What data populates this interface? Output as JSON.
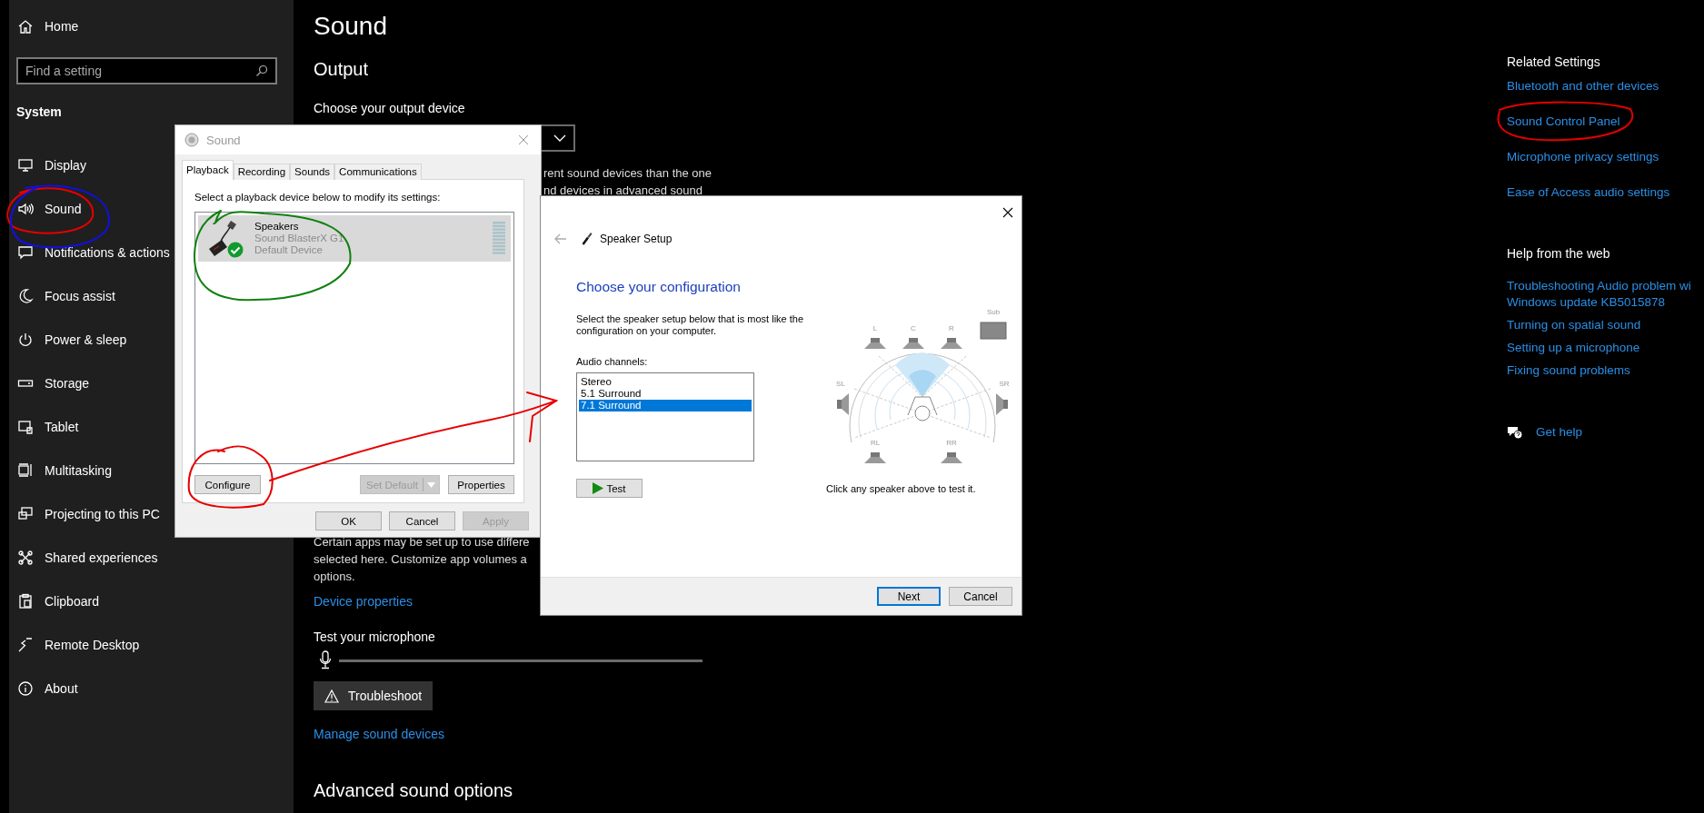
{
  "sidebar": {
    "home": "Home",
    "search": {
      "placeholder": "Find a setting"
    },
    "section": "System",
    "items": [
      {
        "label": "Display"
      },
      {
        "label": "Sound"
      },
      {
        "label": "Notifications & actions"
      },
      {
        "label": "Focus assist"
      },
      {
        "label": "Power & sleep"
      },
      {
        "label": "Storage"
      },
      {
        "label": "Tablet"
      },
      {
        "label": "Multitasking"
      },
      {
        "label": "Projecting to this PC"
      },
      {
        "label": "Shared experiences"
      },
      {
        "label": "Clipboard"
      },
      {
        "label": "Remote Desktop"
      },
      {
        "label": "About"
      }
    ]
  },
  "main": {
    "title": "Sound",
    "output_heading": "Output",
    "output_label": "Choose your output device",
    "output_note": [
      "rent sound devices than the one",
      "nd devices in advanced sound"
    ],
    "app_note": [
      "Certain apps may be set up to use differe",
      "selected here. Customize app volumes a",
      "options."
    ],
    "device_properties": "Device properties",
    "mic_label": "Test your microphone",
    "mic_meter": {
      "level": 0
    },
    "troubleshoot": "Troubleshoot",
    "manage": "Manage sound devices",
    "advanced": "Advanced sound options"
  },
  "related": {
    "title": "Related Settings",
    "links": [
      "Bluetooth and other devices",
      "Sound Control Panel",
      "Microphone privacy settings",
      "Ease of Access audio settings"
    ]
  },
  "help": {
    "title": "Help from the web",
    "links": [
      {
        "lines": [
          "Troubleshooting Audio problem wi",
          "Windows update KB5015878"
        ]
      },
      {
        "lines": [
          "Turning on spatial sound"
        ]
      },
      {
        "lines": [
          "Setting up a microphone"
        ]
      },
      {
        "lines": [
          "Fixing sound problems"
        ]
      }
    ],
    "get_help": "Get help"
  },
  "sound_dialog": {
    "title": "Sound",
    "tabs": [
      {
        "label": "Playback",
        "selected": true
      },
      {
        "label": "Recording",
        "selected": false
      },
      {
        "label": "Sounds",
        "selected": false
      },
      {
        "label": "Communications",
        "selected": false
      }
    ],
    "instruction": "Select a playback device below to modify its settings:",
    "devices": [
      {
        "name": "Speakers",
        "model": "Sound BlasterX G1",
        "status": "Default Device",
        "default": true,
        "selected": true
      }
    ],
    "buttons": [
      {
        "label": "Configure",
        "disabled": false,
        "kind": "plain"
      },
      {
        "label": "Set Default",
        "disabled": true,
        "kind": "split"
      },
      {
        "label": "Properties",
        "disabled": false,
        "kind": "plain"
      }
    ],
    "footer_buttons": [
      {
        "label": "OK",
        "disabled": false
      },
      {
        "label": "Cancel",
        "disabled": false
      },
      {
        "label": "Apply",
        "disabled": true
      }
    ]
  },
  "speaker_setup": {
    "title": "Speaker Setup",
    "heading": "Choose your configuration",
    "description": "Select the speaker setup below that is most like the configuration on your computer.",
    "channels_label": "Audio channels:",
    "channels": [
      {
        "label": "Stereo",
        "selected": false
      },
      {
        "label": "5.1 Surround",
        "selected": false
      },
      {
        "label": "7.1 Surround",
        "selected": true
      }
    ],
    "test": "Test",
    "speakers": [
      "L",
      "C",
      "R",
      "Sub",
      "SL",
      "SR",
      "RL",
      "RR"
    ],
    "hint": "Click any speaker above to test it.",
    "buttons": [
      {
        "label": "Next",
        "default": true
      },
      {
        "label": "Cancel",
        "default": false
      }
    ]
  },
  "ink_marks": [
    {
      "kind": "circle",
      "color": "#e60000"
    },
    {
      "kind": "circle",
      "color": "#1010e0"
    },
    {
      "kind": "circle",
      "color": "#108010"
    },
    {
      "kind": "circle",
      "color": "#e60000"
    },
    {
      "kind": "arrow",
      "color": "#e60000"
    },
    {
      "kind": "circle",
      "color": "#e60000"
    }
  ]
}
